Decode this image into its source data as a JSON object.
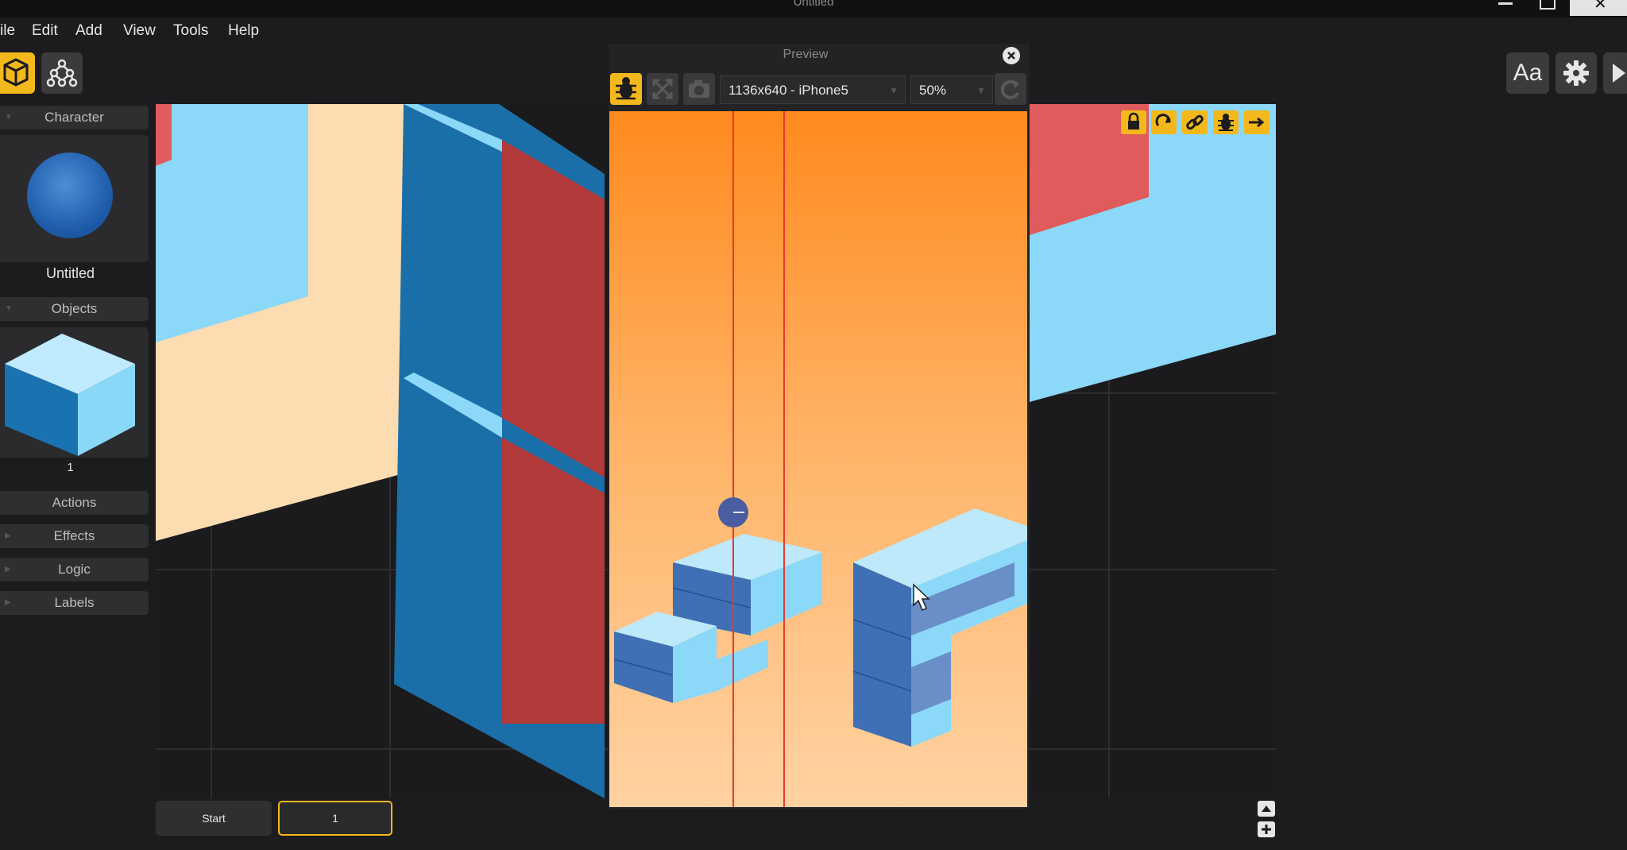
{
  "window": {
    "title": "Untitled"
  },
  "menu": [
    "ile",
    "Edit",
    "Add",
    "View",
    "Tools",
    "Help"
  ],
  "toolbar": {
    "left_icons": [
      "cube-icon",
      "hierarchy-icon"
    ],
    "right": {
      "font_label": "Aa",
      "icons": [
        "gear-icon",
        "play-icon"
      ]
    }
  },
  "sidebar": {
    "character_header": "Character",
    "character_name": "Untitled",
    "objects_header": "Objects",
    "object_label": "1",
    "sections": [
      "Actions",
      "Effects",
      "Logic",
      "Labels"
    ]
  },
  "preview": {
    "title": "Preview",
    "resolution": "1136x640 - iPhone5",
    "zoom": "50%",
    "tool_icons": [
      "bug-icon",
      "expand-icon",
      "camera-icon",
      "refresh-icon"
    ]
  },
  "viewport_tools": [
    "lock-icon",
    "rotate-icon",
    "link-icon",
    "bug-icon",
    "arrow-right-icon"
  ],
  "timeline": {
    "start_label": "Start",
    "scene_label": "1"
  },
  "colors": {
    "accent": "#f3b81c",
    "panel": "#2f2f31",
    "background": "#1c1c1e",
    "cube_light": "#8bd8f8",
    "cube_dark": "#1a6fa8",
    "red_face": "#b23a3a",
    "peach": "#fcdcb0",
    "preview_top": "#ff8a1e",
    "preview_bottom": "#ffd2a2"
  }
}
